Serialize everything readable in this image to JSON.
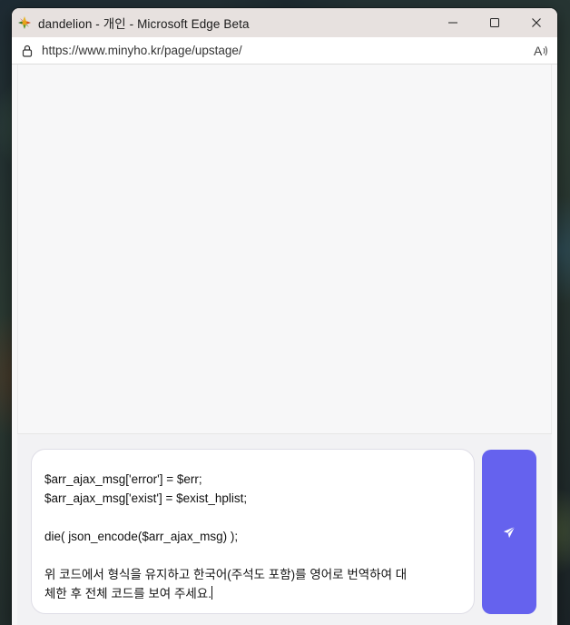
{
  "window": {
    "title": "dandelion - 개인 - Microsoft Edge Beta",
    "app_icon": "dandelion-app-icon",
    "controls": [
      "minimize-icon",
      "maximize-icon",
      "close-icon"
    ]
  },
  "addressbar": {
    "url": "https://www.minyho.kr/page/upstage/",
    "icons": [
      "lock-icon",
      "read-aloud-icon"
    ]
  },
  "prompt": {
    "lines": [
      "$arr_ajax_msg['error'] = $err;",
      "$arr_ajax_msg['exist'] = $exist_hplist;",
      "",
      "die( json_encode($arr_ajax_msg) );",
      "",
      "위 코드에서 형식을 유지하고 한국어(주석도 포함)를 영어로 번역하여 대",
      "체한 후 전체 코드를 보여 주세요."
    ]
  },
  "send_button": {
    "icon": "send-icon",
    "color": "#6562ee"
  }
}
